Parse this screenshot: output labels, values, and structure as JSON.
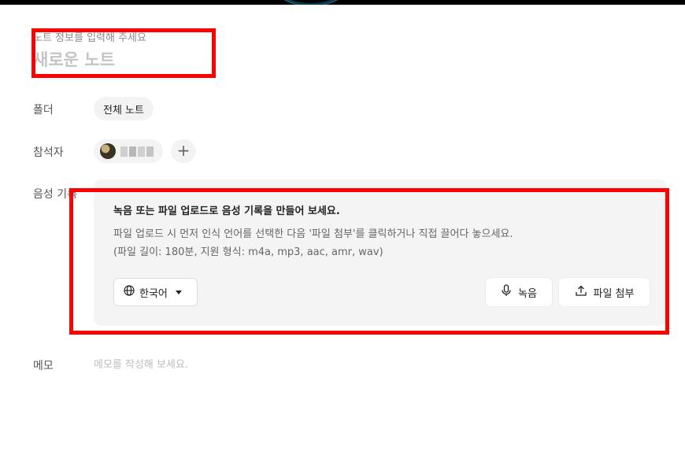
{
  "note": {
    "title_hint": "노트 정보를 입력해 주세요",
    "title_placeholder": "새로운 노트"
  },
  "folder": {
    "label": "폴더",
    "value": "전체 노트"
  },
  "attendees": {
    "label": "참석자",
    "add_symbol": "+"
  },
  "audio": {
    "label": "음성 기록",
    "title": "녹음 또는 파일 업로드로 음성 기록을 만들어 보세요.",
    "desc_line1": "파일 업로드 시 먼저 인식 언어를 선택한 다음 '파일 첨부'를 클릭하거나 직접 끌어다 놓으세요.",
    "desc_line2": "(파일 길이: 180분, 지원 형식: m4a, mp3, aac, amr, wav)",
    "language": "한국어",
    "record_label": "녹음",
    "attach_label": "파일 첨부"
  },
  "memo": {
    "label": "메모",
    "placeholder": "메모를 작성해 보세요."
  },
  "colors": {
    "highlight": "#ff0000",
    "card_background": "#f4f4f4"
  },
  "icons": [
    "globe-icon",
    "caret-down-icon",
    "microphone-icon",
    "upload-icon",
    "plus-icon"
  ]
}
